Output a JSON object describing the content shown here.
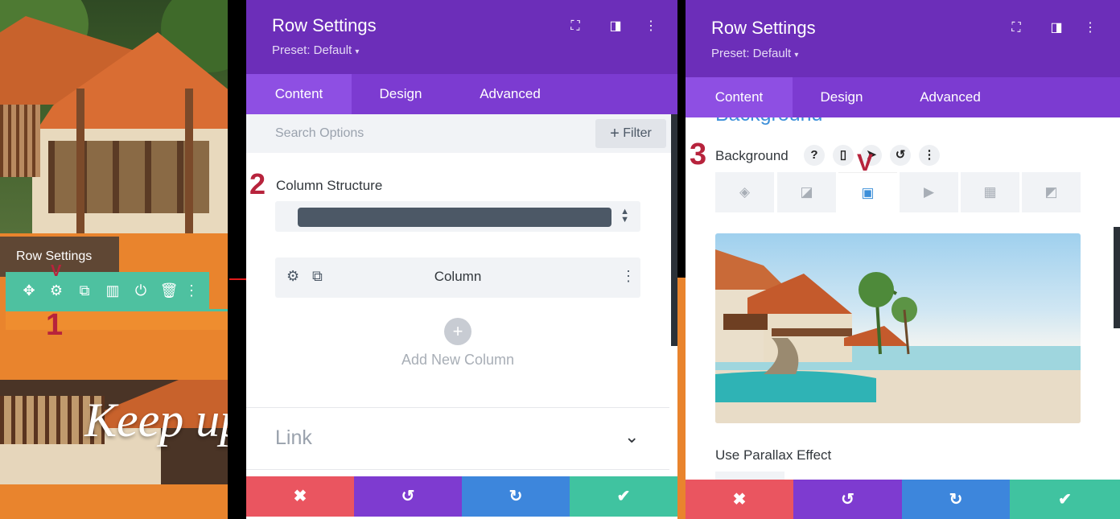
{
  "preview": {
    "tooltip": "Row Settings",
    "heading_text": "Keep up"
  },
  "annotations": [
    "1",
    "2",
    "3",
    "V"
  ],
  "modal_left": {
    "title": "Row Settings",
    "preset": "Preset: Default",
    "tabs": [
      "Content",
      "Design",
      "Advanced"
    ],
    "active_tab": "Content",
    "search_placeholder": "Search Options",
    "filter_label": "Filter",
    "column_structure_label": "Column Structure",
    "column_label": "Column",
    "add_column_label": "Add New Column",
    "link_section": "Link"
  },
  "modal_right": {
    "title": "Row Settings",
    "preset": "Preset: Default",
    "tabs": [
      "Content",
      "Design",
      "Advanced"
    ],
    "active_tab": "Content",
    "section_title": "Background",
    "background_label": "Background",
    "bg_type_icons": [
      "color-icon",
      "gradient-icon",
      "image-icon",
      "video-icon",
      "pattern-icon",
      "mask-icon"
    ],
    "active_bg_type": "image-icon",
    "parallax_label": "Use Parallax Effect"
  },
  "footer_colors": {
    "cancel": "#ea5560",
    "undo": "#7e3bd0",
    "redo": "#3d86dc",
    "save": "#40c3a0"
  },
  "colors": {
    "header": "#6c2eb9",
    "tabs": "#7c3bd1",
    "accent": "#3c8fd9",
    "annotation": "#b7233c",
    "toolbar": "#4ec1a0",
    "orange": "#e9842d"
  }
}
